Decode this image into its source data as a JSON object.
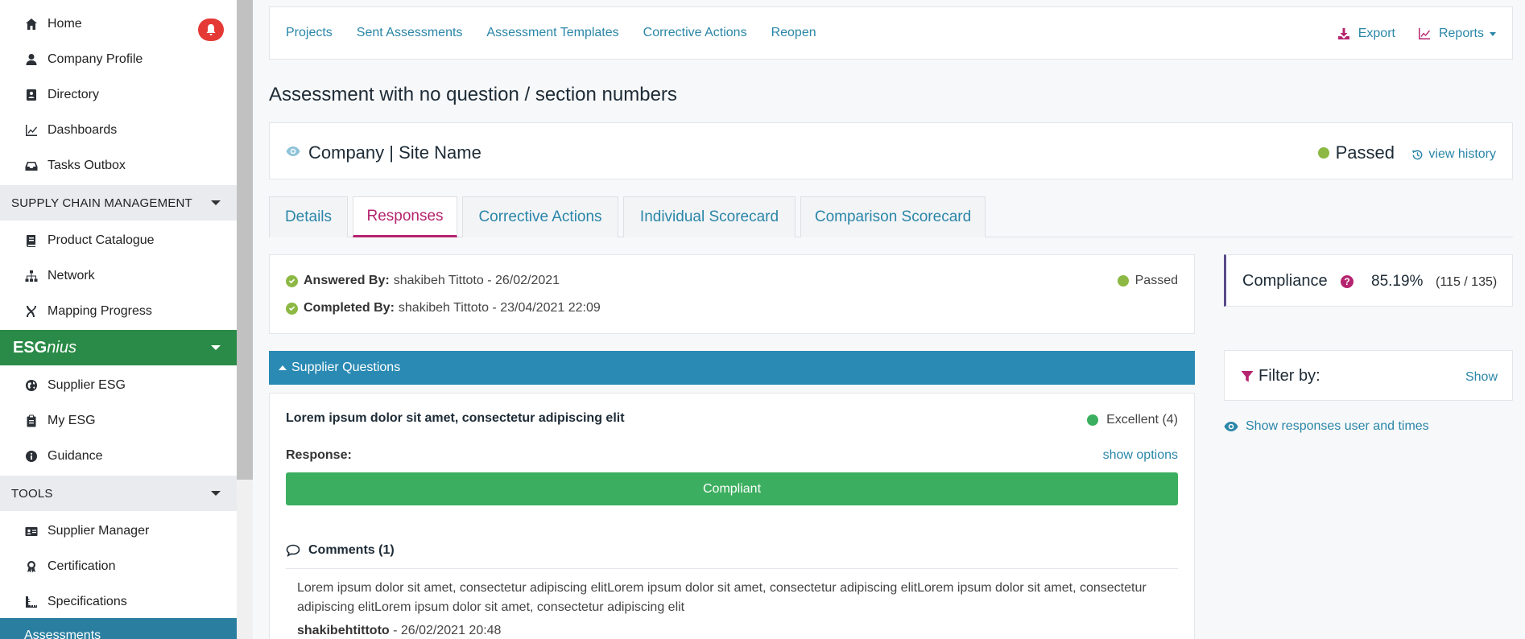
{
  "sidebar": {
    "items_top": [
      {
        "label": "Home",
        "icon": "home-icon"
      },
      {
        "label": "Company Profile",
        "icon": "user-icon"
      },
      {
        "label": "Directory",
        "icon": "address-book-icon"
      },
      {
        "label": "Dashboards",
        "icon": "chart-line-icon"
      },
      {
        "label": "Tasks Outbox",
        "icon": "inbox-icon"
      }
    ],
    "section_supply": "SUPPLY CHAIN MANAGEMENT",
    "items_supply": [
      {
        "label": "Product Catalogue",
        "icon": "book-icon"
      },
      {
        "label": "Network",
        "icon": "sitemap-icon"
      },
      {
        "label": "Mapping Progress",
        "icon": "dna-icon"
      }
    ],
    "brand": {
      "bold": "ESG",
      "light": "nius"
    },
    "items_esg": [
      {
        "label": "Supplier ESG",
        "icon": "globe-icon"
      },
      {
        "label": "My ESG",
        "icon": "clipboard-icon"
      },
      {
        "label": "Guidance",
        "icon": "info-icon"
      }
    ],
    "section_tools": "TOOLS",
    "items_tools": [
      {
        "label": "Supplier Manager",
        "icon": "id-card-icon"
      },
      {
        "label": "Certification",
        "icon": "award-icon"
      },
      {
        "label": "Specifications",
        "icon": "ruler-icon"
      }
    ],
    "active_item": {
      "label": "Assessments",
      "icon": "clipboard-check-icon"
    }
  },
  "topnav": {
    "links": [
      "Projects",
      "Sent Assessments",
      "Assessment Templates",
      "Corrective Actions",
      "Reopen"
    ],
    "export": "Export",
    "reports": "Reports"
  },
  "page": {
    "title": "Assessment with no question / section numbers"
  },
  "company": {
    "name": "Company | Site Name",
    "status": "Passed",
    "history": "view history",
    "status_color": "#8cb843"
  },
  "tabs": [
    "Details",
    "Responses",
    "Corrective Actions",
    "Individual Scorecard",
    "Comparison Scorecard"
  ],
  "answered": {
    "answered_label": "Answered By:",
    "answered_value": "shakibeh Tittoto - 26/02/2021",
    "completed_label": "Completed By:",
    "completed_value": "shakibeh Tittoto - 23/04/2021 22:09",
    "status": "Passed"
  },
  "compliance": {
    "label": "Compliance",
    "help": "?",
    "percent": "85.19%",
    "ratio": "(115 / 135)"
  },
  "filter": {
    "label": "Filter by:",
    "show": "Show"
  },
  "show_responses": "Show responses user and times",
  "supplier_questions": {
    "header": "Supplier Questions",
    "question": {
      "title": "Lorem ipsum dolor sit amet, consectetur adipiscing elit",
      "score": "Excellent (4)",
      "response_label": "Response:",
      "show_options": "show options",
      "response_value": "Compliant",
      "comments_label": "Comments (1)",
      "comment_text": "Lorem ipsum dolor sit amet, consectetur adipiscing elitLorem ipsum dolor sit amet, consectetur adipiscing elitLorem ipsum dolor sit amet, consectetur adipiscing elitLorem ipsum dolor sit amet, consectetur adipiscing elit",
      "comment_author": "shakibehtittoto",
      "comment_date": " - 26/02/2021 20:48"
    }
  },
  "colors": {
    "accent": "#2a86a8",
    "active_tab": "#b5246f",
    "brand_green": "#2a8a47",
    "compliant_green": "#3cae5f",
    "section_blue": "#2a8ab3"
  }
}
